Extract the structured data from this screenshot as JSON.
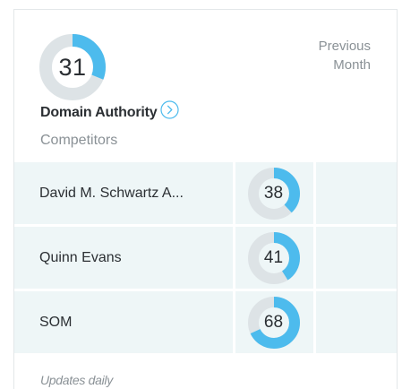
{
  "widget": {
    "score": "31",
    "score_fraction": 0.31,
    "previous_label_line1": "Previous",
    "previous_label_line2": "Month",
    "title": "Domain Authority",
    "subtitle": "Competitors",
    "footer": "Updates daily"
  },
  "competitors": [
    {
      "name": "David M. Schwartz A...",
      "score": "38",
      "fraction": 0.38
    },
    {
      "name": "Quinn Evans",
      "score": "41",
      "fraction": 0.41
    },
    {
      "name": "SOM",
      "score": "68",
      "fraction": 0.68
    }
  ],
  "colors": {
    "accent": "#4dbbed",
    "track": "#dde3e6",
    "row_bg": "#eef6f7",
    "text": "#2b2f33",
    "muted": "#8a9196"
  },
  "icons": {
    "info": "chevron-right-circle-icon"
  }
}
